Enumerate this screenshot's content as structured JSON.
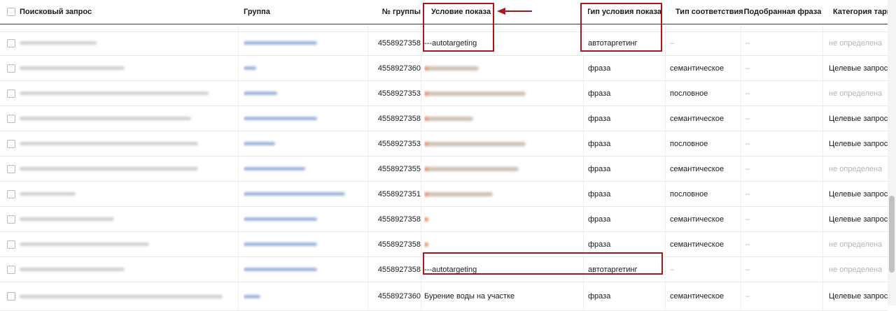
{
  "header": {
    "query": "Поисковый запрос",
    "group": "Группа",
    "group_no": "№ группы",
    "condition": "Условие показа",
    "condition_type": "Тип условия показа",
    "match_type": "Тип соответствия",
    "matched_phrase": "Подобранная фраза",
    "category": "Категория тарге"
  },
  "rows": [
    {
      "group_no": "4558927358",
      "condition": "---autotargeting",
      "condition_type": "автотаргетинг",
      "match_type": "–",
      "matched_phrase": "–",
      "category": "не определена"
    },
    {
      "group_no": "4558927360",
      "condition": "",
      "condition_type": "фраза",
      "match_type": "семантическое",
      "matched_phrase": "–",
      "category": "Целевые запросы"
    },
    {
      "group_no": "4558927353",
      "condition": "",
      "condition_type": "фраза",
      "match_type": "пословное",
      "matched_phrase": "–",
      "category": "не определена"
    },
    {
      "group_no": "4558927358",
      "condition": "",
      "condition_type": "фраза",
      "match_type": "семантическое",
      "matched_phrase": "–",
      "category": "Целевые запросы"
    },
    {
      "group_no": "4558927353",
      "condition": "",
      "condition_type": "фраза",
      "match_type": "пословное",
      "matched_phrase": "–",
      "category": "Целевые запросы"
    },
    {
      "group_no": "4558927355",
      "condition": "",
      "condition_type": "фраза",
      "match_type": "семантическое",
      "matched_phrase": "–",
      "category": "не определена"
    },
    {
      "group_no": "4558927351",
      "condition": "",
      "condition_type": "фраза",
      "match_type": "пословное",
      "matched_phrase": "–",
      "category": "Целевые запросы"
    },
    {
      "group_no": "4558927358",
      "condition": "",
      "condition_type": "фраза",
      "match_type": "семантическое",
      "matched_phrase": "–",
      "category": "Целевые запросы"
    },
    {
      "group_no": "4558927358",
      "condition": "",
      "condition_type": "фраза",
      "match_type": "семантическое",
      "matched_phrase": "–",
      "category": "не определена"
    },
    {
      "group_no": "4558927358",
      "condition": "---autotargeting",
      "condition_type": "автотаргетинг",
      "match_type": "–",
      "matched_phrase": "–",
      "category": "не определена"
    },
    {
      "group_no": "4558927360",
      "condition": "Бурение воды на участке",
      "condition_type": "фраза",
      "match_type": "семантическое",
      "matched_phrase": "–",
      "category": "Целевые запросы"
    }
  ],
  "colors": {
    "highlight": "#b0141c",
    "link": "#3366cc",
    "muted": "#b4b4b4"
  }
}
